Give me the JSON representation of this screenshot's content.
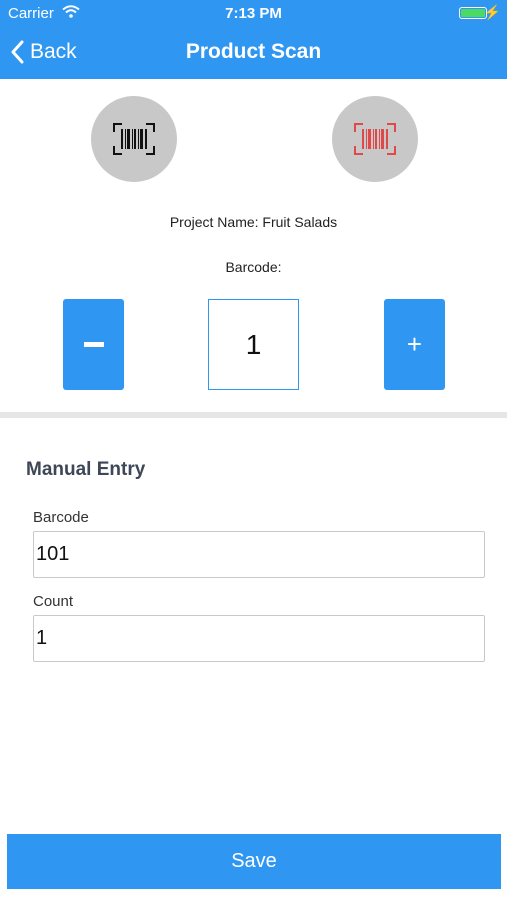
{
  "status_bar": {
    "carrier": "Carrier",
    "time": "7:13 PM"
  },
  "nav": {
    "back_label": "Back",
    "title": "Product Scan",
    "back_icon": "chevron-left-icon"
  },
  "scanner": {
    "left_icon": "barcode-scan-icon",
    "right_icon": "barcode-scan-red-icon"
  },
  "project_label": "Project Name: Fruit Salads",
  "barcode_label": "Barcode:",
  "stepper": {
    "minus_label": "−",
    "value": "1",
    "plus_label": "+"
  },
  "manual_entry": {
    "title": "Manual Entry",
    "barcode_label": "Barcode",
    "barcode_value": "101",
    "count_label": "Count",
    "count_value": "1"
  },
  "save_label": "Save",
  "colors": {
    "accent": "#2f97f2",
    "scan_bg": "#c8c8c8",
    "scan_red": "#e0484a"
  }
}
